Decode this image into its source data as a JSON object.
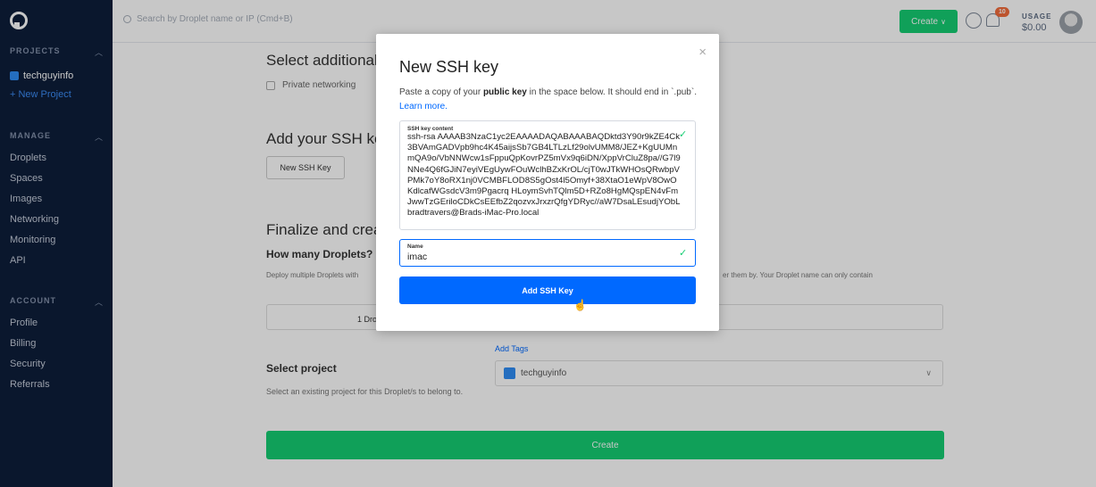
{
  "sidebar": {
    "projects_heading": "PROJECTS",
    "project_name": "techguyinfo",
    "new_project": "+ New Project",
    "manage_heading": "MANAGE",
    "manage_items": [
      "Droplets",
      "Spaces",
      "Images",
      "Networking",
      "Monitoring",
      "API"
    ],
    "account_heading": "ACCOUNT",
    "account_items": [
      "Profile",
      "Billing",
      "Security",
      "Referrals"
    ]
  },
  "topbar": {
    "search_placeholder": "Search by Droplet name or IP (Cmd+B)",
    "create_label": "Create",
    "notification_count": "10",
    "usage_label": "USAGE",
    "usage_value": "$0.00"
  },
  "main": {
    "additional_options_title": "Select additional options",
    "private_networking": "Private networking",
    "ssh_title": "Add your SSH keys",
    "new_ssh_button": "New SSH Key",
    "finalize_title": "Finalize and create",
    "how_many": "How many Droplets?",
    "deploy_text": "Deploy multiple Droplets with",
    "deploy_text2": "er them by. Your Droplet name can only contain",
    "droplet_count": "1  Droplet",
    "add_tags": "Add Tags",
    "select_project_title": "Select project",
    "select_project_desc": "Select an existing project for this Droplet/s to belong to.",
    "project_value": "techguyinfo",
    "create_button": "Create"
  },
  "modal": {
    "title": "New SSH key",
    "desc_pre": "Paste a copy of your ",
    "desc_bold": "public key",
    "desc_post": " in the space below. It should end in `.pub`.",
    "learn_more": "Learn more.",
    "key_label": "SSH key content",
    "key_value": "ssh-rsa AAAAB3NzaC1yc2EAAAADAQABAAABAQDktd3Y90r9kZE4Ck3BVAmGADVpb9hc4K45aijsSb7GB4LTLzLf29olvUMM8/JEZ+KgUUMnmQA9o/VbNNWcw1sFppuQpKovrPZ5mVx9q6iDN/XppVrCluZ8pa//G7l9NNe4Q6fGJiN7eyiVEgUywFOuWclhBZxKrOL/cjT0wJTkWHOsQRwbpVPMk7oY8oRX1nj0VCMBFLOD8S5gOst4l5Omyf+38XtaO1eWpV8OwOKdlcafWGsdcV3m9Pgacrq HLoymSvhTQlm5D+RZo8HgMQspEN4vFmJwwTzGEriloCDkCsEEfbZ2qozvxJrxzrQfgYDRyc//aW7DsaLEsudjYObLbradtravers@Brads-iMac-Pro.local",
    "name_label": "Name",
    "name_value": "imac",
    "add_button": "Add SSH Key",
    "close_symbol": "×"
  }
}
